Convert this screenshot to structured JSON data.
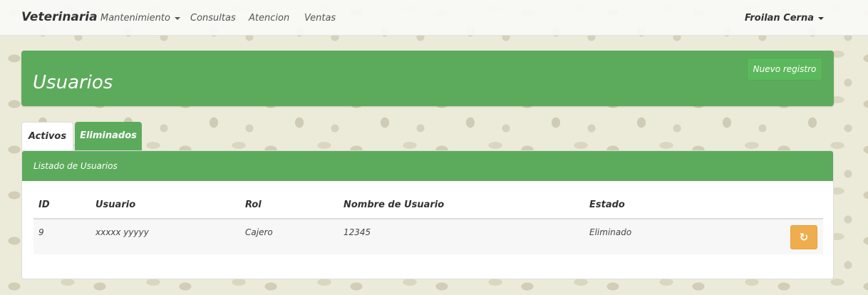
{
  "navbar": {
    "brand": "Veterinaria",
    "items": [
      {
        "label": "Mantenimiento",
        "has_dropdown": true
      },
      {
        "label": "Consultas"
      },
      {
        "label": "Atencion"
      },
      {
        "label": "Ventas"
      }
    ],
    "user": "Froilan Cerna"
  },
  "header": {
    "title": "Usuarios",
    "new_button": "Nuevo registro"
  },
  "tabs": [
    {
      "label": "Activos",
      "active": true
    },
    {
      "label": "Eliminados",
      "active": false
    }
  ],
  "panel": {
    "title": "Listado de Usuarios",
    "columns": [
      "ID",
      "Usuario",
      "Rol",
      "Nombre de Usuario",
      "Estado"
    ],
    "rows": [
      {
        "id": "9",
        "usuario": "xxxxx yyyyy",
        "rol": "Cajero",
        "nombre_usuario": "12345",
        "estado": "Eliminado"
      }
    ],
    "row_action_icon": "refresh-icon"
  },
  "colors": {
    "header_green": "#5cab5c",
    "action_orange": "#f0ad4e"
  }
}
